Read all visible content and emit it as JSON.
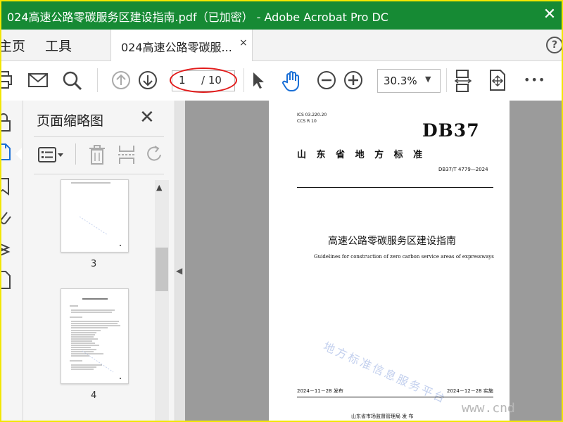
{
  "window": {
    "title": "024高速公路零碳服务区建设指南.pdf（已加密） - Adobe Acrobat Pro DC",
    "close_glyph": "✕"
  },
  "nav": {
    "home_label": "主页",
    "tools_label": "工具",
    "doc_tab_label": "024高速公路零碳服...",
    "doc_tab_close": "×",
    "help_glyph": "?"
  },
  "toolbar": {
    "page_current": "1",
    "page_total": "/ 10",
    "zoom": "30.3%",
    "zoom_caret": "▼",
    "more_glyph": "•••"
  },
  "thumbnails": {
    "title": "页面缩略图",
    "close_glyph": "✕",
    "pages": [
      {
        "number": "3"
      },
      {
        "number": "4"
      }
    ]
  },
  "document": {
    "ics": "ICS  03.220.20",
    "ccs": "CCS R 10",
    "logo": "DB37",
    "region": "山  东  省  地  方  标  准",
    "std_no": "DB37/T 4779—2024",
    "title_cn": "高速公路零碳服务区建设指南",
    "title_en": "Guidelines for construction of zero carbon service areas of expressways",
    "watermark": "地方标准信息服务平台",
    "publish_date": "2024－11－28 发布",
    "implement_date": "2024－12－28 实施",
    "issuer": "山东省市场监督管理局    发  布",
    "site_watermark": "www.cnd"
  },
  "colors": {
    "titlebar": "#168a34",
    "frame": "#f2e600",
    "annotation": "#e21b1b",
    "hand_tool": "#1a6fd6"
  }
}
